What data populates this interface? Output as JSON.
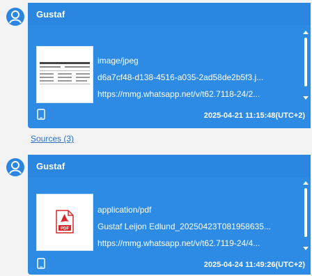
{
  "messages": [
    {
      "sender": "Gustaf",
      "mime_type": "image/jpeg",
      "file_name": "d6a7cf48-d138-4516-a035-2ad58de2b5f3.j...",
      "url": "https://mmg.whatsapp.net/v/t62.7118-24/2...",
      "timestamp": "2025-04-21 11:15:48(UTC+2)",
      "thumbnail_icon": "image-thumbnail-icon"
    },
    {
      "sender": "Gustaf",
      "mime_type": "application/pdf",
      "file_name": "Gustaf Leijon Edlund_20250423T081958635...",
      "url": "https://mmg.whatsapp.net/v/t62.7119-24/4...",
      "timestamp": "2025-04-24 11:49:26(UTC+2)",
      "thumbnail_icon": "pdf-icon",
      "pdf_label": "PDF"
    }
  ],
  "sources_label": "Sources (3)",
  "colors": {
    "bubble": "#2e8be3",
    "header": "#2a86df",
    "avatar": "#2a86df",
    "link": "#2a6fc4",
    "pdf_red": "#d9262a"
  }
}
